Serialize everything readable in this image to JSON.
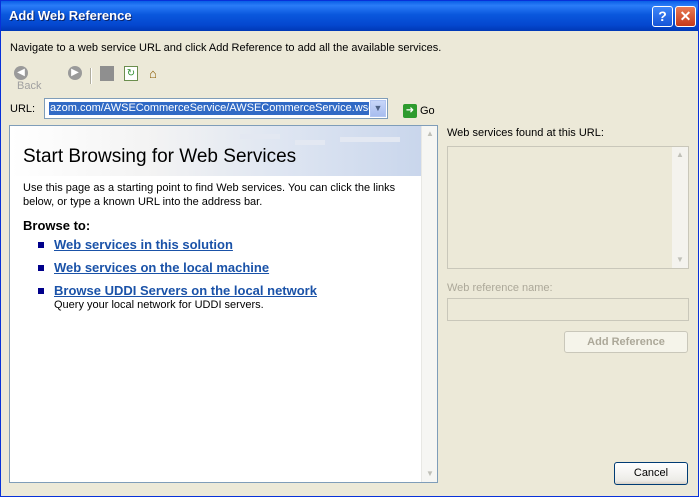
{
  "window": {
    "title": "Add Web Reference",
    "help_glyph": "?",
    "close_glyph": "✕"
  },
  "instructions": "Navigate to a web service URL and click Add Reference to add all the available services.",
  "toolbar": {
    "back_label": "Back",
    "icons": [
      "back-arrow-icon",
      "forward-arrow-icon",
      "stop-icon",
      "refresh-icon",
      "home-icon"
    ]
  },
  "url": {
    "label": "URL:",
    "value": "azom.com/AWSECommerceService/AWSECommerceService.wsdl",
    "go_label": "Go"
  },
  "browser": {
    "heading": "Start Browsing for Web Services",
    "description": "Use this page as a starting point to find Web services. You can click the links below, or type a known URL into the address bar.",
    "browse_to": "Browse to:",
    "links": [
      {
        "label": "Web services in this solution",
        "sub": ""
      },
      {
        "label": "Web services on the local machine",
        "sub": ""
      },
      {
        "label": "Browse UDDI Servers on the local network",
        "sub": "Query your local network for UDDI servers."
      }
    ]
  },
  "services_panel": {
    "found_label": "Web services found at this URL:",
    "ref_name_label": "Web reference name:",
    "ref_name_value": "",
    "add_button": "Add Reference"
  },
  "cancel_button": "Cancel",
  "colors": {
    "title_bar": "#0a58dd",
    "link": "#1a52a8",
    "selection": "#316ac5"
  }
}
